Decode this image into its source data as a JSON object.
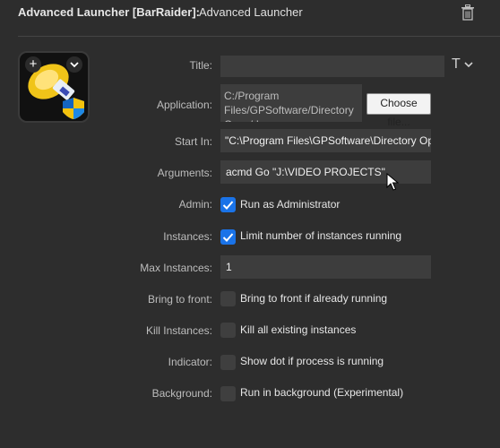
{
  "header": {
    "plugin_name": "Advanced Launcher [BarRaider]:",
    "action_name": "Advanced Launcher",
    "trash_icon": "trash-icon"
  },
  "key": {
    "add_icon": "plus-icon",
    "menu_icon": "chevron-down-icon",
    "image": "usb-drive-icon"
  },
  "fields": {
    "title": {
      "label": "Title:",
      "value": "",
      "title_icon": "T"
    },
    "application": {
      "label": "Application:",
      "value": "C:/Program Files/GPSoftware/Directory Opus/dopus.exe",
      "button": "Choose file..."
    },
    "start_in": {
      "label": "Start In:",
      "value": "\"C:\\Program Files\\GPSoftware\\Directory Opus\""
    },
    "arguments": {
      "label": "Arguments:",
      "value": "acmd Go  \"J:\\VIDEO PROJECTS\""
    },
    "admin": {
      "label": "Admin:",
      "text": "Run as Administrator",
      "checked": true
    },
    "instances": {
      "label": "Instances:",
      "text": "Limit number of instances running",
      "checked": true
    },
    "max_instances": {
      "label": "Max Instances:",
      "value": "1"
    },
    "bring_to_front": {
      "label": "Bring to front:",
      "text": "Bring to front if already running",
      "checked": false
    },
    "kill_instances": {
      "label": "Kill Instances:",
      "text": "Kill all existing instances",
      "checked": false
    },
    "indicator": {
      "label": "Indicator:",
      "text": "Show dot if process is running",
      "checked": false
    },
    "background": {
      "label": "Background:",
      "text": "Run in background (Experimental)",
      "checked": false
    }
  },
  "colors": {
    "accent": "#1a73e8",
    "panel": "#2d2d2d",
    "input": "#3d3d3d"
  }
}
